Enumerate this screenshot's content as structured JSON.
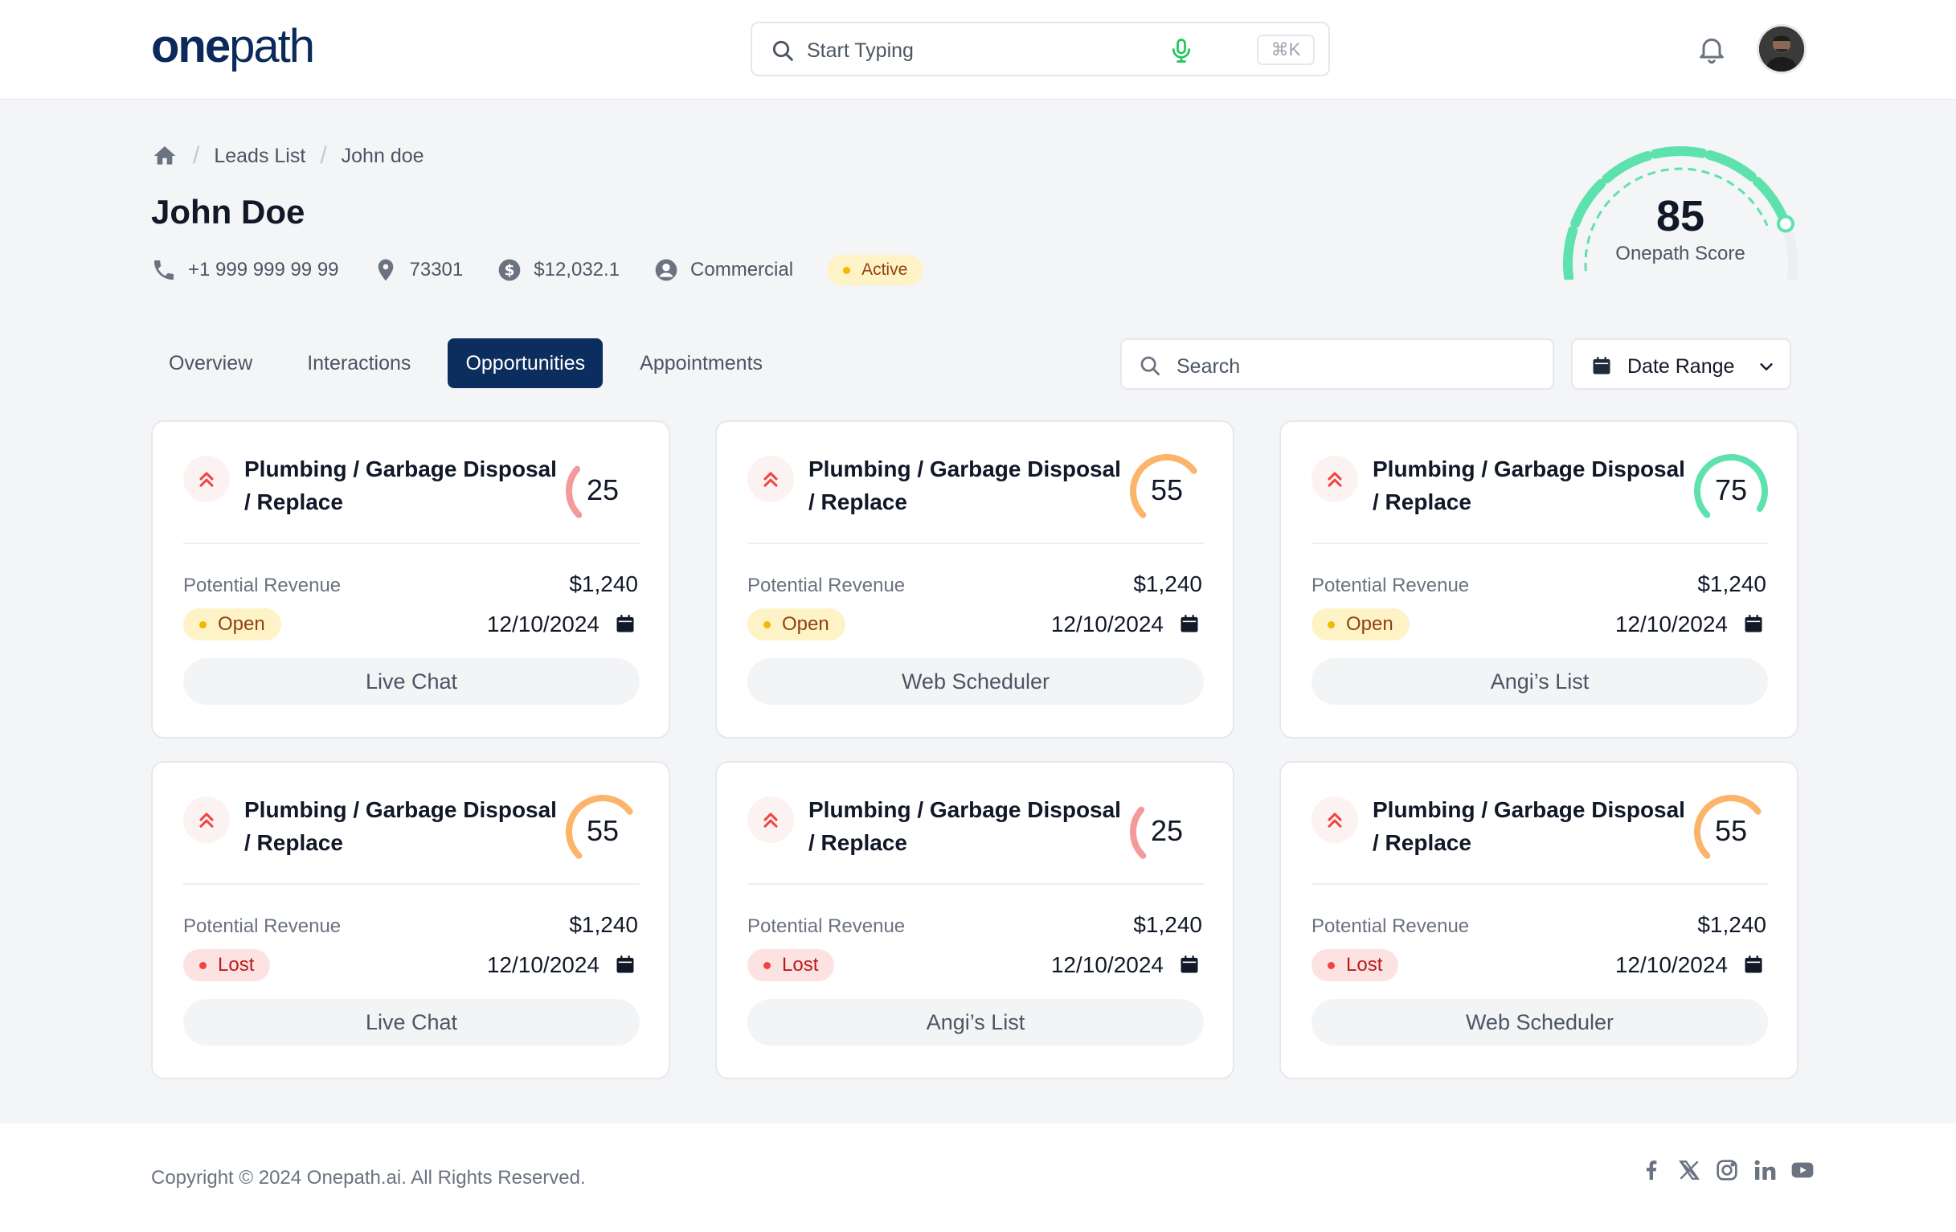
{
  "header": {
    "logo_main": "one",
    "logo_accent": "path",
    "search_placeholder": "Start Typing",
    "shortcut": "⌘K"
  },
  "breadcrumb": {
    "items": [
      "Leads List",
      "John doe"
    ]
  },
  "lead": {
    "name": "John Doe",
    "phone": "+1 999 999 99 99",
    "zip": "73301",
    "value": "$12,032.1",
    "type": "Commercial",
    "status": "Active",
    "score": "85",
    "score_label": "Onepath Score",
    "score_fraction": 0.85
  },
  "tabs": {
    "items": [
      "Overview",
      "Interactions",
      "Opportunities",
      "Appointments"
    ],
    "active": "Opportunities"
  },
  "filters": {
    "search_placeholder": "Search",
    "date_range_label": "Date Range"
  },
  "colors": {
    "brand": "#0b2e5f",
    "score_green": "#5ee2ad",
    "score_orange": "#fcb46a",
    "score_red": "#f49a9a",
    "open": "#f5b800",
    "lost": "#ef4444"
  },
  "opportunities": [
    {
      "title": "Plumbing / Garbage Disposal / Replace",
      "score": "25",
      "score_fraction": 0.25,
      "revenue_label": "Potential Revenue",
      "revenue": "$1,240",
      "status": "Open",
      "date": "12/10/2024",
      "source": "Live Chat"
    },
    {
      "title": "Plumbing / Garbage Disposal / Replace",
      "score": "55",
      "score_fraction": 0.55,
      "revenue_label": "Potential Revenue",
      "revenue": "$1,240",
      "status": "Open",
      "date": "12/10/2024",
      "source": "Web Scheduler"
    },
    {
      "title": "Plumbing / Garbage Disposal / Replace",
      "score": "75",
      "score_fraction": 0.75,
      "revenue_label": "Potential Revenue",
      "revenue": "$1,240",
      "status": "Open",
      "date": "12/10/2024",
      "source": "Angi’s List"
    },
    {
      "title": "Plumbing / Garbage Disposal / Replace",
      "score": "55",
      "score_fraction": 0.55,
      "revenue_label": "Potential Revenue",
      "revenue": "$1,240",
      "status": "Lost",
      "date": "12/10/2024",
      "source": "Live Chat"
    },
    {
      "title": "Plumbing / Garbage Disposal / Replace",
      "score": "25",
      "score_fraction": 0.25,
      "revenue_label": "Potential Revenue",
      "revenue": "$1,240",
      "status": "Lost",
      "date": "12/10/2024",
      "source": "Angi’s List"
    },
    {
      "title": "Plumbing / Garbage Disposal / Replace",
      "score": "55",
      "score_fraction": 0.55,
      "revenue_label": "Potential Revenue",
      "revenue": "$1,240",
      "status": "Lost",
      "date": "12/10/2024",
      "source": "Web Scheduler"
    }
  ],
  "footer": {
    "copyright": "Copyright © 2024 Onepath.ai. All Rights Reserved.",
    "socials": [
      "facebook-icon",
      "x-icon",
      "instagram-icon",
      "linkedin-icon",
      "youtube-icon"
    ]
  }
}
